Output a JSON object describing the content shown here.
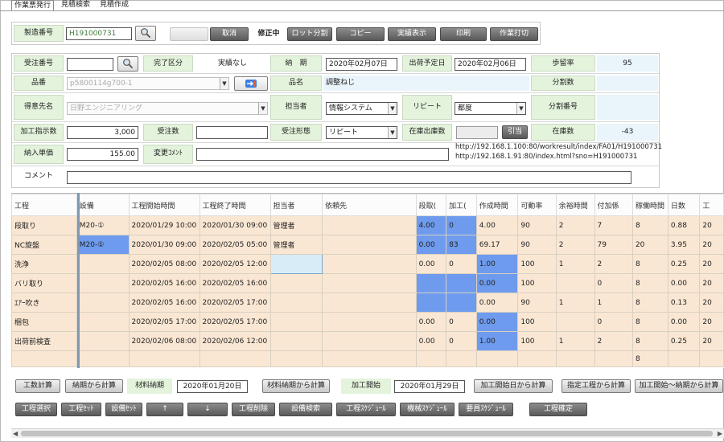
{
  "tabs": [
    "作業票発行",
    "見積検索",
    "見積作成"
  ],
  "toolbar": {
    "seizo_label": "製造番号",
    "seizo_value": "H191000731",
    "ghost_button": "",
    "cancel": "取消",
    "mode": "修正中",
    "lot": "ロット分割",
    "copy": "コピー",
    "jisseki": "実績表示",
    "print": "印刷",
    "sagyou": "作業打切"
  },
  "form": {
    "juchu_label": "受注番号",
    "juchu_value": "",
    "kanryo_label": "完了区分",
    "kanryo_value": "実績なし",
    "nouki_label": "納　期",
    "nouki_value": "2020年02月07日",
    "shukka_label": "出荷予定日",
    "shukka_value": "2020年02月06日",
    "budomari_label": "歩留率",
    "budomari_value": "95",
    "hinban_label": "品番",
    "hinban_value": "p5800114g700-1",
    "hinmei_label": "品名",
    "hinmei_value": "調整ねじ",
    "bunkatsu_label": "分割数",
    "tokui_label": "得意先名",
    "tokui_value": "日野エンジニアリング",
    "tantou_label": "担当者",
    "tantou_value": "情報システム",
    "repeat_label": "リピート",
    "repeat_value": "都度",
    "bunkatsu_no_label": "分割番号",
    "kakou_label": "加工指示数",
    "kakou_value": "3,000",
    "juchusu_label": "受注数",
    "juchusu_value": "",
    "keitai_label": "受注形態",
    "keitai_value": "リピート",
    "zaiko_shukka_label": "在庫出庫数",
    "zaiko_shukka_value": "",
    "hikiate": "引当",
    "zaiko_label": "在庫数",
    "zaiko_value": "-43",
    "tanka_label": "納入単価",
    "tanka_value": "155.00",
    "henko_label": "変更ｺﾒﾝﾄ",
    "henko_value": "",
    "url1": "http://192.168.1.100:80/workresult/index/FA01/H191000731",
    "url2": "http://192.168.1.91:80/index.html?sno=H191000731",
    "comment_label": "コメント",
    "comment_value": ""
  },
  "grid": {
    "headers": [
      "工程",
      "設備",
      "工程開始時間",
      "工程終了時間",
      "担当者",
      "依頼先",
      "段取(",
      "加工(",
      "作成時間",
      "可動率",
      "余裕時間",
      "付加係",
      "稼働時間",
      "日数",
      "工"
    ],
    "rows": [
      [
        "段取り",
        "M20-①",
        "2020/01/29 10:00",
        "2020/01/30 09:00",
        "管理者",
        "",
        "4.00",
        "0",
        "4.00",
        "90",
        "2",
        "7",
        "8",
        "0.88",
        "20"
      ],
      [
        "NC旋盤",
        "M20-①",
        "2020/01/30 09:00",
        "2020/02/05 05:00",
        "管理者",
        "",
        "0.00",
        "83",
        "69.17",
        "90",
        "2",
        "79",
        "20",
        "3.95",
        "20"
      ],
      [
        "洗浄",
        "",
        "2020/02/05 08:00",
        "2020/02/05 12:00",
        "",
        "",
        "0.00",
        "0",
        "1.00",
        "100",
        "1",
        "2",
        "8",
        "0.25",
        "20"
      ],
      [
        "バリ取り",
        "",
        "2020/02/05 16:00",
        "2020/02/05 16:00",
        "",
        "",
        "",
        "",
        "0.00",
        "100",
        "",
        "0",
        "8",
        "0.00",
        "20"
      ],
      [
        "ｴｱｰ吹き",
        "",
        "2020/02/05 16:00",
        "2020/02/05 17:00",
        "",
        "",
        "",
        "",
        "0.00",
        "90",
        "1",
        "1",
        "8",
        "0.13",
        "20"
      ],
      [
        "梱包",
        "",
        "2020/02/05 17:00",
        "2020/02/05 17:00",
        "",
        "",
        "0.00",
        "0",
        "0.00",
        "100",
        "",
        "0",
        "8",
        "0.00",
        "20"
      ],
      [
        "出荷前検査",
        "",
        "2020/02/06 08:00",
        "2020/02/06 12:00",
        "",
        "",
        "0.00",
        "0",
        "1.00",
        "100",
        "1",
        "2",
        "8",
        "0.25",
        "20"
      ]
    ],
    "footer_total": "8"
  },
  "bottom1": {
    "kosu": "工数計算",
    "nouki_calc": "納期から計算",
    "zairyo_label": "材料納期",
    "zairyo_value": "2020年01月20日",
    "zairyo_calc": "材料納期から計算",
    "kaishi_label": "加工開始",
    "kaishi_value": "2020年01月29日",
    "kaishi_calc": "加工開始日から計算",
    "shitei_calc": "指定工程から計算",
    "range_calc": "加工開始～納期から計算"
  },
  "bottom2": {
    "koutei_sentaku": "工程選択",
    "koutei_set": "工程ｾｯﾄ",
    "setsubi_set": "設備ｾｯﾄ",
    "up": "↑",
    "down": "↓",
    "koutei_sakujo": "工程削除",
    "setsubi_kensaku": "設備検索",
    "koutei_sched": "工程ｽｹｼﾞｭｰﾙ",
    "kikai_sched": "機械ｽｹｼﾞｭｰﾙ",
    "youin_sched": "要員ｽｹｼﾞｭｰﾙ",
    "koutei_kakutei": "工程確定"
  }
}
